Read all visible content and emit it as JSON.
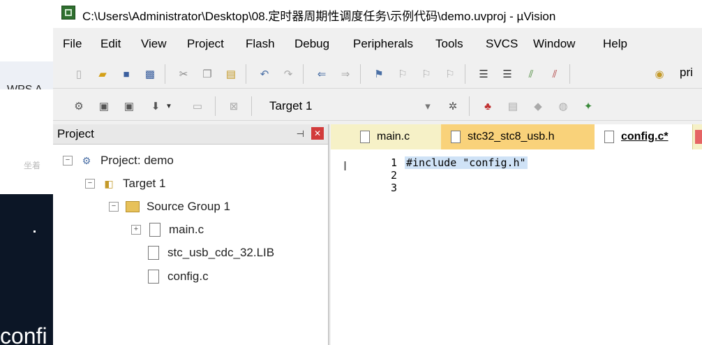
{
  "background": {
    "taskbar_label": "WPS A",
    "faint_text": "坐着",
    "bottom_text": "confi"
  },
  "window": {
    "title": "C:\\Users\\Administrator\\Desktop\\08.定时器周期性调度任务\\示例代码\\demo.uvproj - µVision"
  },
  "menu": [
    "File",
    "Edit",
    "View",
    "Project",
    "Flash",
    "Debug",
    "Peripherals",
    "Tools",
    "SVCS",
    "Window",
    "Help"
  ],
  "toolbar": {
    "clipped_label": "pri",
    "target_value": "Target 1"
  },
  "project_panel": {
    "title": "Project",
    "pin_icon": "pin-icon",
    "close_icon": "close-icon",
    "tree": {
      "root": "Project: demo",
      "target": "Target 1",
      "group": "Source Group 1",
      "files": [
        "main.c",
        "stc_usb_cdc_32.LIB",
        "config.c"
      ]
    }
  },
  "editor": {
    "tabs": [
      "main.c",
      "stc32_stc8_usb.h",
      "config.c*"
    ],
    "active_tab": 2,
    "line_numbers": [
      "1",
      "2",
      "3"
    ],
    "code": "#include \"config.h\""
  },
  "colors": {
    "tab_bar": "#f6f1c7",
    "selection": "#cfe2f6",
    "close_red": "#d23b3b"
  }
}
